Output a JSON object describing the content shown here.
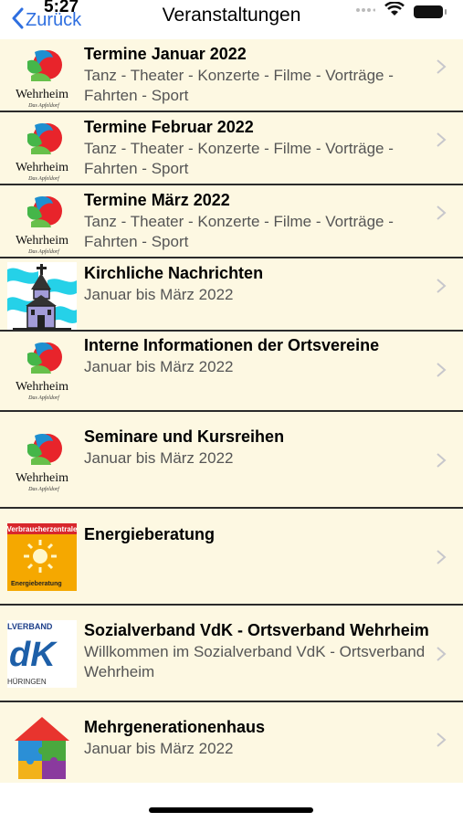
{
  "status": {
    "time": "5:27"
  },
  "nav": {
    "back_label": "Zurück",
    "title": "Veranstaltungen"
  },
  "logos": {
    "wehrheim": {
      "name": "Wehrheim",
      "tagline": "Das Apfeldorf"
    },
    "vz_label": "Verbraucherzentrale",
    "vz_sub": "Energieberatung",
    "vdk_top": "LVERBAND",
    "vdk_main": "dK",
    "vdk_bottom": "HÜRINGEN"
  },
  "rows": [
    {
      "title": "Termine Januar 2022",
      "subtitle": "Tanz - Theater - Konzerte - Filme - Vorträge - Fahrten - Sport",
      "icon": "wehrheim-logo"
    },
    {
      "title": "Termine Februar 2022",
      "subtitle": "Tanz - Theater - Konzerte - Filme - Vorträge - Fahrten - Sport",
      "icon": "wehrheim-logo"
    },
    {
      "title": "Termine März 2022",
      "subtitle": "Tanz - Theater - Konzerte - Filme - Vorträge - Fahrten - Sport",
      "icon": "wehrheim-logo"
    },
    {
      "title": "Kirchliche Nachrichten",
      "subtitle": "Januar bis März 2022",
      "icon": "church-icon"
    },
    {
      "title": "Interne Informationen der Ortsvereine",
      "subtitle": "Januar bis März 2022",
      "icon": "wehrheim-logo"
    },
    {
      "title": "Seminare und Kursreihen",
      "subtitle": "Januar bis März 2022",
      "icon": "wehrheim-logo"
    },
    {
      "title": "Energieberatung",
      "subtitle": "",
      "icon": "verbraucherzentrale-logo"
    },
    {
      "title": "Sozialverband VdK - Ortsverband Wehrheim",
      "subtitle": "Willkommen im Sozialverband VdK - Ortsverband Wehrheim",
      "icon": "vdk-logo"
    },
    {
      "title": "Mehrgenerationenhaus",
      "subtitle": "Januar bis März 2022",
      "icon": "house-puzzle-icon"
    }
  ]
}
